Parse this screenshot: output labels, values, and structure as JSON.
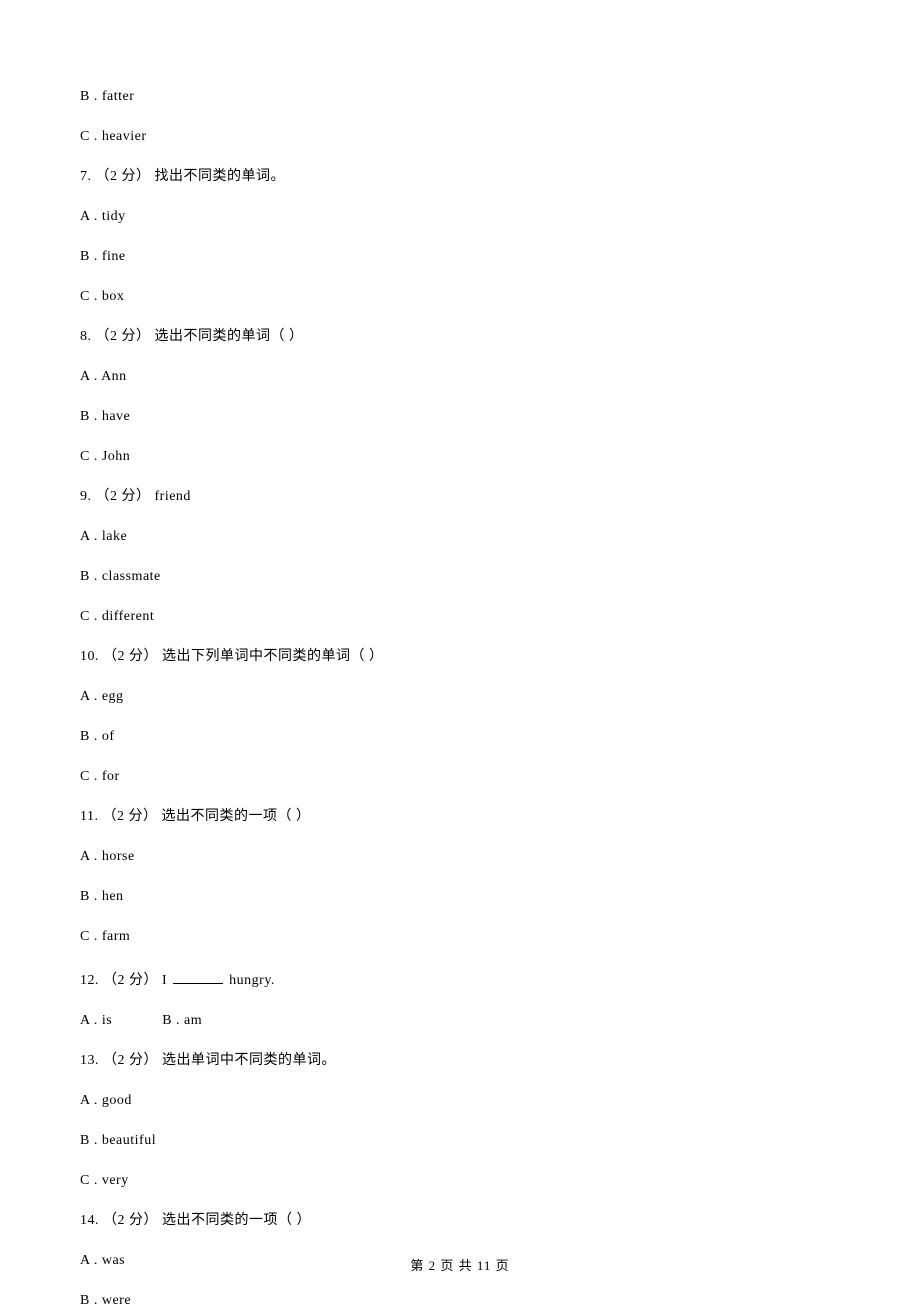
{
  "lines": {
    "l1": "B . fatter",
    "l2": "C . heavier",
    "l3": "7. （2 分） 找出不同类的单词。",
    "l4": "A . tidy",
    "l5": "B . fine",
    "l6": "C . box",
    "l7": "8. （2 分） 选出不同类的单词（   ）",
    "l8": "A . Ann",
    "l9": "B . have",
    "l10": "C . John",
    "l11": "9. （2 分）  friend",
    "l12": "A . lake",
    "l13": "B . classmate",
    "l14": "C . different",
    "l15": "10. （2 分） 选出下列单词中不同类的单词（   ）",
    "l16": "A . egg",
    "l17": "B . of",
    "l18": "C . for",
    "l19": "11. （2 分） 选出不同类的一项（   ）",
    "l20": "A . horse",
    "l21": "B . hen",
    "l22": "C . farm",
    "l23_prefix": "12. （2 分） I ",
    "l23_suffix": " hungry.",
    "l24a": "A . is",
    "l24b": "B . am",
    "l25": "13. （2 分） 选出单词中不同类的单词。",
    "l26": "A . good",
    "l27": "B . beautiful",
    "l28": "C . very",
    "l29": "14. （2 分） 选出不同类的一项（   ）",
    "l30": "A . was",
    "l31": "B . were"
  },
  "footer": {
    "text": "第 2 页 共 11 页"
  }
}
